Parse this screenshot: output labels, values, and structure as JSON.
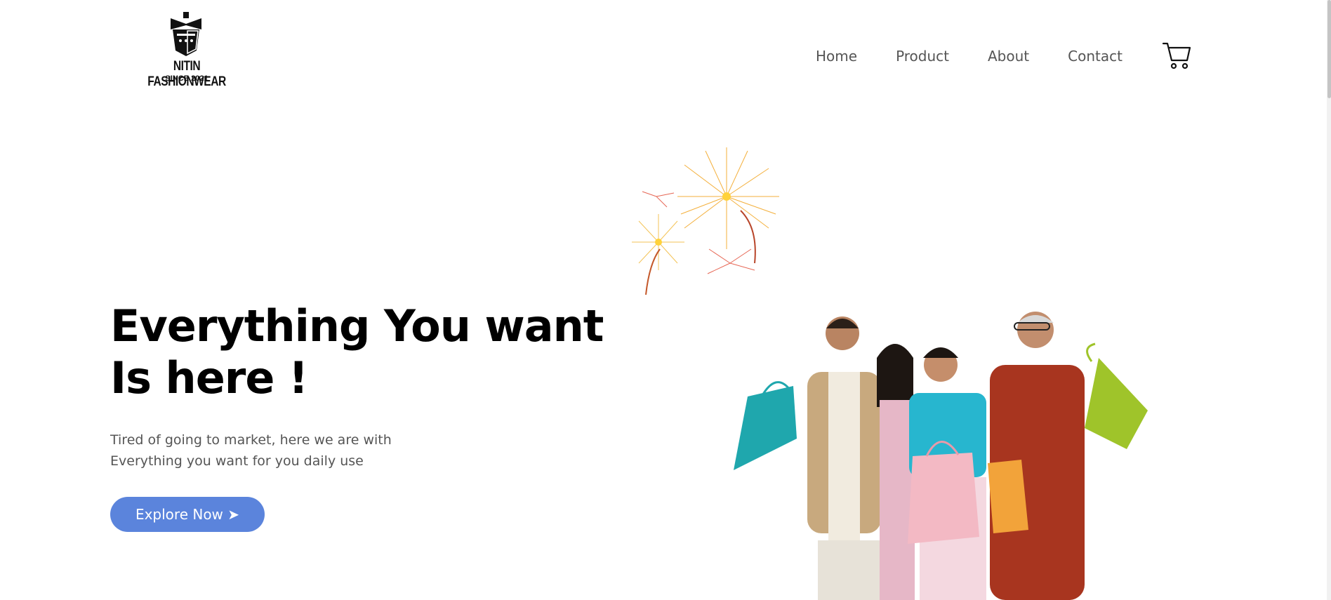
{
  "brand": {
    "name": "NITIN FASHIONWEAR",
    "since": "SINCE 2021"
  },
  "nav": {
    "items": [
      {
        "label": "Home"
      },
      {
        "label": "Product"
      },
      {
        "label": "About"
      },
      {
        "label": "Contact"
      }
    ],
    "cart_icon": "cart-icon"
  },
  "hero": {
    "title_line1": "Everything You want",
    "title_line2": "Is here !",
    "subtitle_line1": "Tired of going to market, here we are with",
    "subtitle_line2": "Everything you want for you daily use",
    "button_label": "Explore Now ➤"
  },
  "colors": {
    "button": "#5b84dc",
    "title": "#000000",
    "nav_text": "#555555"
  }
}
